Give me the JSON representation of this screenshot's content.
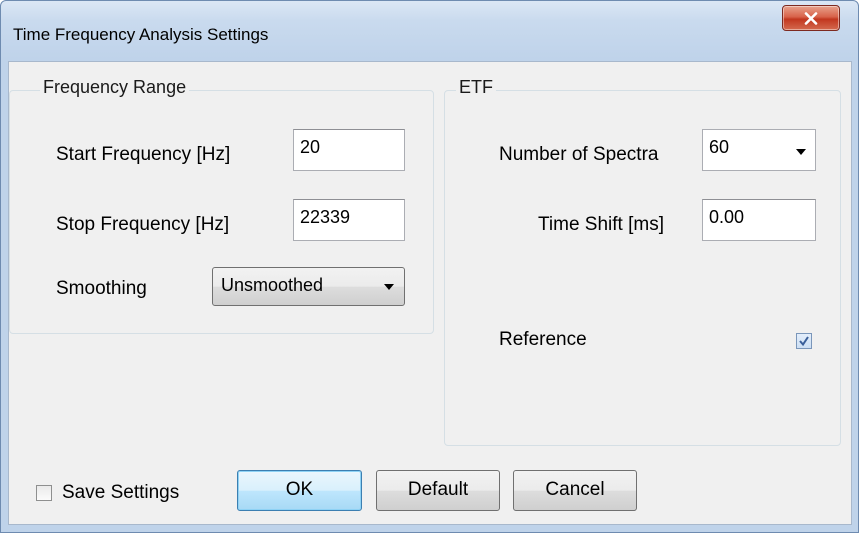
{
  "window": {
    "title": "Time Frequency Analysis Settings",
    "close_icon": "close-icon"
  },
  "frequency_range": {
    "title": "Frequency Range",
    "start_label": "Start Frequency [Hz]",
    "start_value": "20",
    "stop_label": "Stop Frequency [Hz]",
    "stop_value": "22339",
    "smoothing_label": "Smoothing",
    "smoothing_value": "Unsmoothed"
  },
  "etf": {
    "title": "ETF",
    "spectra_label": "Number of Spectra",
    "spectra_value": "60",
    "time_shift_label": "Time Shift [ms]",
    "time_shift_value": "0.00",
    "reference_label": "Reference",
    "reference_checked": true
  },
  "footer": {
    "save_settings_label": "Save Settings",
    "save_settings_checked": false,
    "ok_label": "OK",
    "default_label": "Default",
    "cancel_label": "Cancel"
  },
  "colors": {
    "close_button": "#c9452c",
    "default_button_border": "#3c7fb1"
  }
}
